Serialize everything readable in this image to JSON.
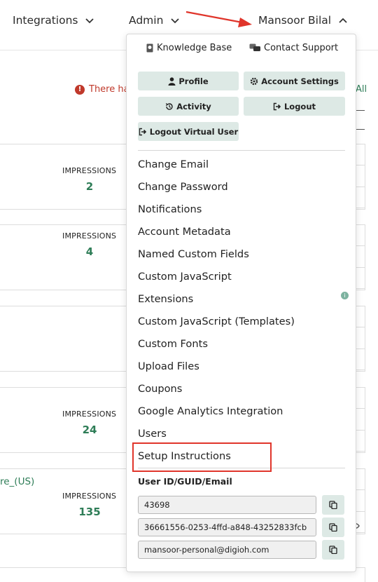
{
  "nav": {
    "integrations": "Integrations",
    "admin": "Admin",
    "user": "Mansoor Bilal"
  },
  "background": {
    "warning_text": "There ha",
    "all_link": "All",
    "cards": [
      {
        "label": "IMPRESSIONS",
        "value": "2"
      },
      {
        "label": "IMPRESSIONS",
        "value": "4"
      },
      {
        "label": "",
        "value": ""
      },
      {
        "label": "IMPRESSIONS",
        "value": "24"
      },
      {
        "name": "re_(US)",
        "label": "IMPRESSIONS",
        "value": "135"
      }
    ]
  },
  "dropdown": {
    "links": {
      "knowledge_base": "Knowledge Base",
      "contact_support": "Contact Support"
    },
    "buttons": {
      "profile": "Profile",
      "account_settings": "Account Settings",
      "activity": "Activity",
      "logout": "Logout",
      "logout_virtual": "Logout Virtual User"
    },
    "menu": [
      "Change Email",
      "Change Password",
      "Notifications",
      "Account Metadata",
      "Named Custom Fields",
      "Custom JavaScript",
      "Extensions",
      "Custom JavaScript (Templates)",
      "Custom Fonts",
      "Upload Files",
      "Coupons",
      "Google Analytics Integration",
      "Users",
      "Setup Instructions"
    ],
    "ids": {
      "label": "User ID/GUID/Email",
      "user_id": "43698",
      "guid": "36661556-0253-4ffd-a848-43252833fcb",
      "email": "mansoor-personal@digioh.com"
    }
  },
  "colors": {
    "accent_green": "#2e7d57",
    "button_bg": "#dde9e5",
    "warning_red": "#c0392b",
    "annotation_red": "#e0352b"
  },
  "icons": {
    "nav_chevron": "chevron-down-icon",
    "user_chevron": "chevron-up-icon",
    "knowledge_base": "book-icon",
    "contact_support": "chat-icon",
    "profile": "user-icon",
    "account_settings": "gear-icon",
    "activity": "history-icon",
    "logout": "logout-icon",
    "copy": "copy-icon",
    "warning": "alert-icon",
    "eye": "eye-icon"
  }
}
